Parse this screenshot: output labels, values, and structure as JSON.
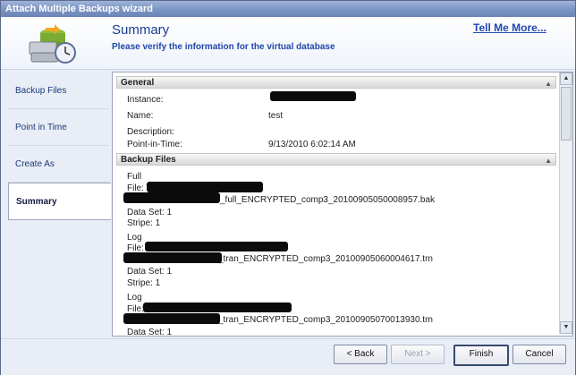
{
  "window": {
    "title": "Attach Multiple Backups wizard"
  },
  "header": {
    "title": "Summary",
    "subtitle": "Please verify the information for the virtual database",
    "help_link": "Tell Me More..."
  },
  "sidebar": {
    "items": [
      {
        "label": "Backup Files"
      },
      {
        "label": "Point in Time"
      },
      {
        "label": "Create As"
      },
      {
        "label": "Summary",
        "selected": true
      }
    ]
  },
  "general": {
    "heading": "General",
    "fields": [
      {
        "label": "Instance:",
        "value": ""
      },
      {
        "label": "Name:",
        "value": "test"
      },
      {
        "label": "Description:",
        "value": ""
      },
      {
        "label": "Point-in-Time:",
        "value": "9/13/2010 6:02:14 AM"
      }
    ]
  },
  "backup_files": {
    "heading": "Backup Files",
    "entries": [
      {
        "type": "Full",
        "file_label": "File: \\\\",
        "file_tail": "_full_ENCRYPTED_comp3_20100905050008957.bak",
        "data_set": "Data Set: 1",
        "stripe": "Stripe: 1"
      },
      {
        "type": "Log",
        "file_label": "File:",
        "file_tail": "_tran_ENCRYPTED_comp3_20100905060004617.trn",
        "data_set": "Data Set: 1",
        "stripe": "Stripe: 1"
      },
      {
        "type": "Log",
        "file_label": "File:",
        "file_tail": "_tran_ENCRYPTED_comp3_20100905070013930.trn",
        "data_set": "Data Set: 1"
      }
    ]
  },
  "buttons": {
    "back": "< Back",
    "next": "Next >",
    "finish": "Finish",
    "cancel": "Cancel"
  }
}
